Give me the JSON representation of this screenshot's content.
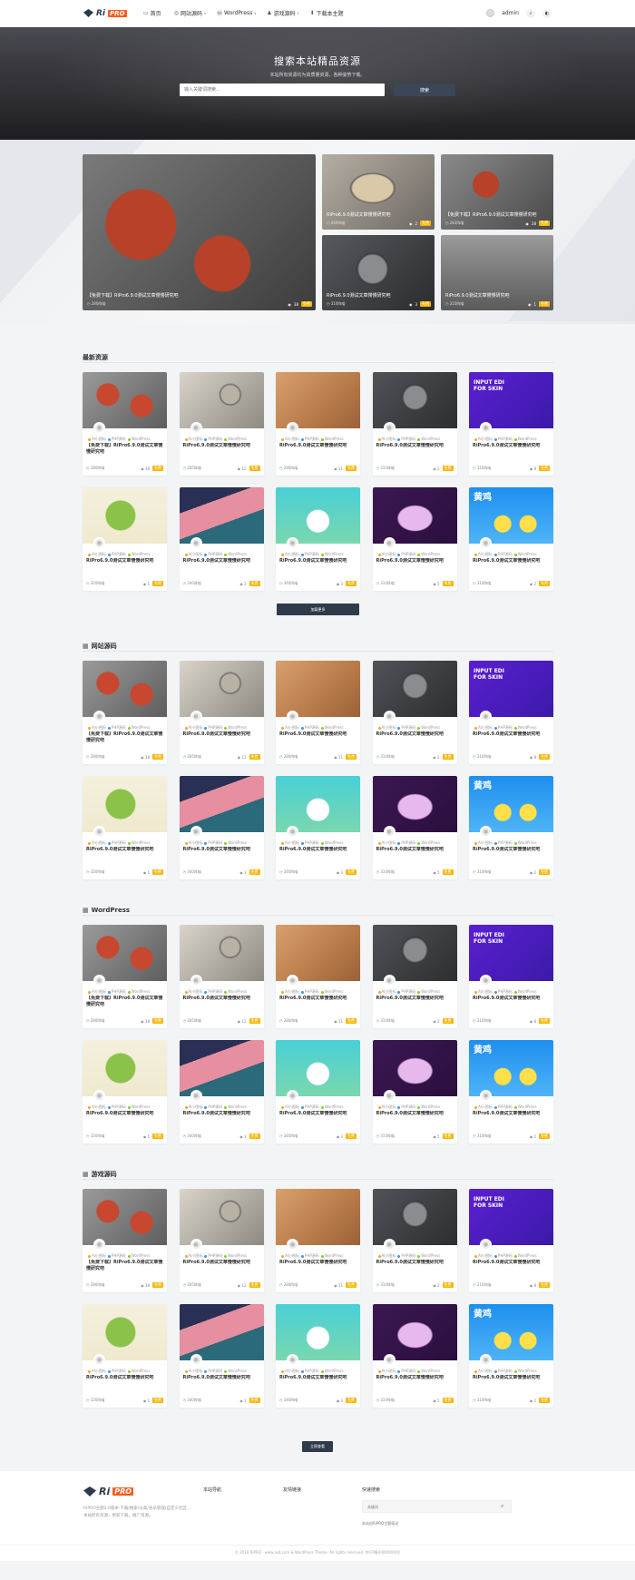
{
  "header": {
    "logo_text": "Ri",
    "logo_badge": "PRO",
    "nav": [
      {
        "icon": "monitor-icon",
        "glyph": "▭",
        "label": "首页",
        "caret": ""
      },
      {
        "icon": "compass-icon",
        "glyph": "◎",
        "label": "网站源码",
        "caret": "▾"
      },
      {
        "icon": "wordpress-icon",
        "glyph": "Ⓦ",
        "label": "WordPress",
        "caret": "▾"
      },
      {
        "icon": "user-icon",
        "glyph": "♟",
        "label": "游戏源码",
        "caret": "▾"
      },
      {
        "icon": "download-icon",
        "glyph": "⬇",
        "label": "下载本主题",
        "caret": ""
      }
    ],
    "user": "admin"
  },
  "hero": {
    "title": "搜索本站精品资源",
    "subtitle": "本站所有资源均为高质量资源，各种姿势下载。",
    "search_placeholder": "输入关键词搜索...",
    "search_button": "搜索"
  },
  "featured": [
    {
      "title": "【免费下载】RiPro6.9.0测试文章慢慢研究吧",
      "meta": "◷ 280阵喵",
      "views": "38",
      "badge": "免费"
    },
    {
      "title": "RiPro6.9.0测试文章慢慢研究吧",
      "meta": "◷ 460阵喵",
      "views": "2",
      "badge": "免费"
    },
    {
      "title": "【免费下载】RiPro6.9.0测试文章慢慢研究吧",
      "meta": "◷ 283阵喵",
      "views": "28",
      "badge": "免费"
    },
    {
      "title": "RiPro6.9.0测试文章慢慢研究吧",
      "meta": "◷ 310阵喵",
      "views": "3",
      "badge": "免费"
    },
    {
      "title": "RiPro6.9.0测试文章慢慢研究吧",
      "meta": "◷ 310阵喵",
      "views": "1",
      "badge": "免费"
    }
  ],
  "sections": [
    {
      "title": "最新资源",
      "icon": ""
    },
    {
      "title": "网站源码",
      "icon": "▦"
    },
    {
      "title": "WordPress",
      "icon": "▦"
    },
    {
      "title": "游戏源码",
      "icon": "▦"
    }
  ],
  "card_cats": [
    "AI小图标",
    "PHP源码",
    "WordPress"
  ],
  "cards": [
    {
      "title": "【免费下载】RiPro6.9.0测试文章慢慢研究吧",
      "time": "◷ 280阵喵",
      "count": "38",
      "badge": "免费"
    },
    {
      "title": "RiPro6.9.0测试文章慢慢研究吧",
      "time": "◷ 285阵喵",
      "count": "12",
      "badge": "免费"
    },
    {
      "title": "RiPro6.9.0测试文章慢慢研究吧",
      "time": "◷ 280阵喵",
      "count": "11",
      "badge": "免费"
    },
    {
      "title": "RiPro6.9.0测试文章慢慢研究吧",
      "time": "◷ 310阵喵",
      "count": "2",
      "badge": "免费"
    },
    {
      "title": "RiPro6.9.0测试文章慢慢研究吧",
      "time": "◷ 310阵喵",
      "count": "8",
      "badge": "免费"
    },
    {
      "title": "RiPro6.9.0测试文章慢慢研究吧",
      "time": "◷ 320阵喵",
      "count": "1",
      "badge": "免费"
    },
    {
      "title": "RiPro6.9.0测试文章慢慢研究吧",
      "time": "◷ 340阵喵",
      "count": "3",
      "badge": "免费"
    },
    {
      "title": "RiPro6.9.0测试文章慢慢研究吧",
      "time": "◷ 340阵喵",
      "count": "3",
      "badge": "免费"
    },
    {
      "title": "RiPro6.9.0测试文章慢慢研究吧",
      "time": "◷ 310阵喵",
      "count": "5",
      "badge": "免费"
    },
    {
      "title": "RiPro6.9.0测试文章慢慢研究吧",
      "time": "◷ 310阵喵",
      "count": "2",
      "badge": "免费"
    }
  ],
  "load_more": "加载更多",
  "more_btn": "立即查看",
  "footer": {
    "logo_text": "Ri",
    "logo_badge": "PRO",
    "desc": "RiPRO主题2.0版本·下载/搜索/分类/会员管理/自定义社区...",
    "desc2": "本站所有资源，更新下载，推广资源。",
    "col1": "本站导航",
    "col2": "友情链接",
    "col3": "快速搜索",
    "search_placeholder": "关键词",
    "link": "本站由RiPRO主题驱动",
    "copyright": "© 2019 RiPRO · www.asd.com & WordPress Theme. All rights reserved. 京ICP备00000000号"
  },
  "colors": {
    "accent": "#f7b500",
    "dark": "#2f3a4a",
    "brand_orange": "#ff5a1f"
  }
}
